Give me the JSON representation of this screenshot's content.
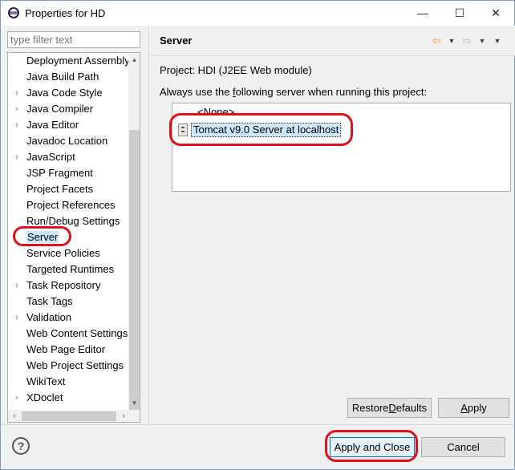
{
  "window": {
    "title": "Properties for HD",
    "minimize_glyph": "—",
    "maximize_glyph": "☐",
    "close_glyph": "✕"
  },
  "filter": {
    "placeholder": "type filter text"
  },
  "tree": {
    "items": [
      {
        "label": "Deployment Assembly",
        "expandable": false
      },
      {
        "label": "Java Build Path",
        "expandable": false
      },
      {
        "label": "Java Code Style",
        "expandable": true
      },
      {
        "label": "Java Compiler",
        "expandable": true
      },
      {
        "label": "Java Editor",
        "expandable": true
      },
      {
        "label": "Javadoc Location",
        "expandable": false
      },
      {
        "label": "JavaScript",
        "expandable": true
      },
      {
        "label": "JSP Fragment",
        "expandable": false
      },
      {
        "label": "Project Facets",
        "expandable": false
      },
      {
        "label": "Project References",
        "expandable": false
      },
      {
        "label": "Run/Debug Settings",
        "expandable": false
      },
      {
        "label": "Server",
        "expandable": false,
        "selected": true
      },
      {
        "label": "Service Policies",
        "expandable": false
      },
      {
        "label": "Targeted Runtimes",
        "expandable": false
      },
      {
        "label": "Task Repository",
        "expandable": true
      },
      {
        "label": "Task Tags",
        "expandable": false
      },
      {
        "label": "Validation",
        "expandable": true
      },
      {
        "label": "Web Content Settings",
        "expandable": false
      },
      {
        "label": "Web Page Editor",
        "expandable": false
      },
      {
        "label": "Web Project Settings",
        "expandable": false
      },
      {
        "label": "WikiText",
        "expandable": false
      },
      {
        "label": "XDoclet",
        "expandable": true
      }
    ]
  },
  "page": {
    "title": "Server",
    "project_line": "Project: HDI (J2EE Web module)",
    "always_prefix": "Always use the ",
    "always_mnemonic": "f",
    "always_suffix": "ollowing server when running this project:",
    "none_item": "<None>",
    "server_item": "Tomcat v9.0 Server at localhost"
  },
  "buttons": {
    "restore_prefix": "Restore ",
    "restore_mnemonic": "D",
    "restore_suffix": "efaults",
    "apply_mnemonic": "A",
    "apply_suffix": "pply",
    "apply_close": "Apply and Close",
    "cancel": "Cancel",
    "help": "?"
  },
  "colors": {
    "annotation": "#e0101a",
    "selection": "#cce8ff",
    "default_button_border": "#0078d7"
  }
}
